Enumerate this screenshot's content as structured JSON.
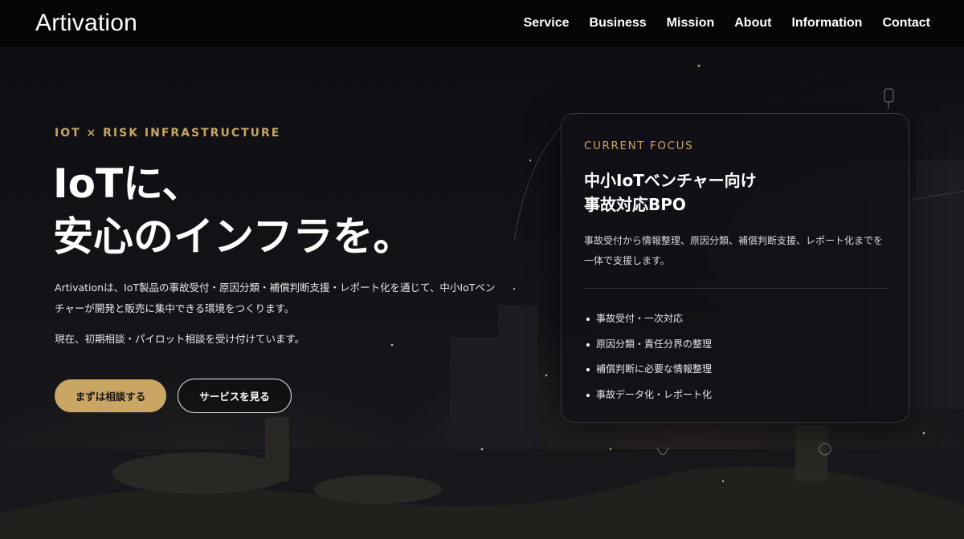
{
  "header": {
    "logo": "Artivation",
    "nav": [
      "Service",
      "Business",
      "Mission",
      "About",
      "Information",
      "Contact"
    ]
  },
  "hero": {
    "eyebrow": "IOT × RISK INFRASTRUCTURE",
    "title_line1": "IoTに、",
    "title_line2": "安心のインフラを。",
    "description": "Artivationは、IoT製品の事故受付・原因分類・補償判断支援・レポート化を通じて、中小IoTベンチャーが開発と販売に集中できる環境をつくります。",
    "note": "現在、初期相談・パイロット相談を受け付けています。",
    "primary_button": "まずは相談する",
    "secondary_button": "サービスを見る"
  },
  "focus_card": {
    "eyebrow": "CURRENT FOCUS",
    "title_line1": "中小IoTベンチャー向け",
    "title_line2": "事故対応BPO",
    "description": "事故受付から情報整理、原因分類、補償判断支援、レポート化までを一体で支援します。",
    "items": [
      "事故受付・一次対応",
      "原因分類・責任分界の整理",
      "補償判断に必要な情報整理",
      "事故データ化・レポート化"
    ]
  },
  "colors": {
    "accent": "#c9a664",
    "header_bg": "#050507",
    "page_bg": "#0b0b0f"
  }
}
